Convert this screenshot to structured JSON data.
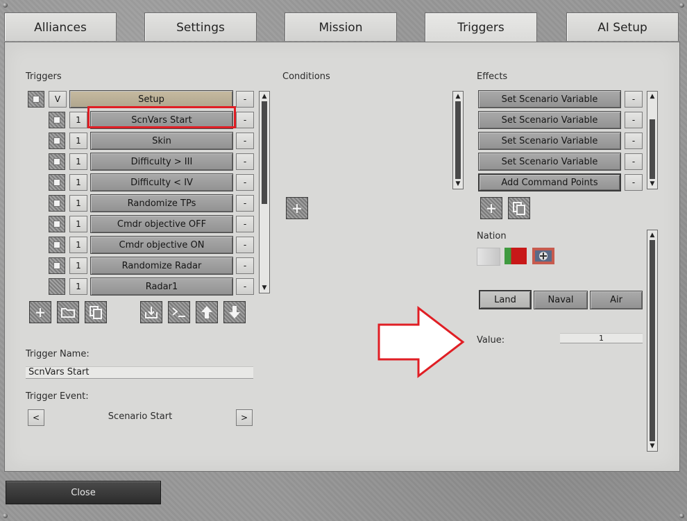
{
  "tabs": [
    "Alliances",
    "Settings",
    "Mission",
    "Triggers",
    "AI Setup"
  ],
  "triggers": {
    "label": "Triggers",
    "setup_v": "V",
    "setup_label": "Setup",
    "minus": "-",
    "items": [
      {
        "num": "1",
        "label": "ScnVars Start"
      },
      {
        "num": "1",
        "label": "Skin"
      },
      {
        "num": "1",
        "label": "Difficulty > III"
      },
      {
        "num": "1",
        "label": "Difficulty < IV"
      },
      {
        "num": "1",
        "label": "Randomize TPs"
      },
      {
        "num": "1",
        "label": "Cmdr objective OFF"
      },
      {
        "num": "1",
        "label": "Cmdr objective ON"
      },
      {
        "num": "1",
        "label": "Randomize Radar"
      },
      {
        "num": "1",
        "label": "Radar1"
      }
    ]
  },
  "trigger_name": {
    "label": "Trigger Name:",
    "value": "ScnVars Start"
  },
  "trigger_event": {
    "label": "Trigger Event:",
    "value": "Scenario Start",
    "prev": "<",
    "next": ">"
  },
  "conditions": {
    "label": "Conditions"
  },
  "effects": {
    "label": "Effects",
    "items": [
      "Set Scenario Variable",
      "Set Scenario Variable",
      "Set Scenario Variable",
      "Set Scenario Variable",
      "Add Command Points"
    ]
  },
  "nation": {
    "label": "Nation"
  },
  "branches": [
    "Land",
    "Naval",
    "Air"
  ],
  "value_field": {
    "label": "Value:",
    "value": "1"
  },
  "close_label": "Close",
  "colors": {
    "highlight_red": "#e01e24",
    "panel": "#d9d9d7",
    "button": "#9e9e9e"
  }
}
